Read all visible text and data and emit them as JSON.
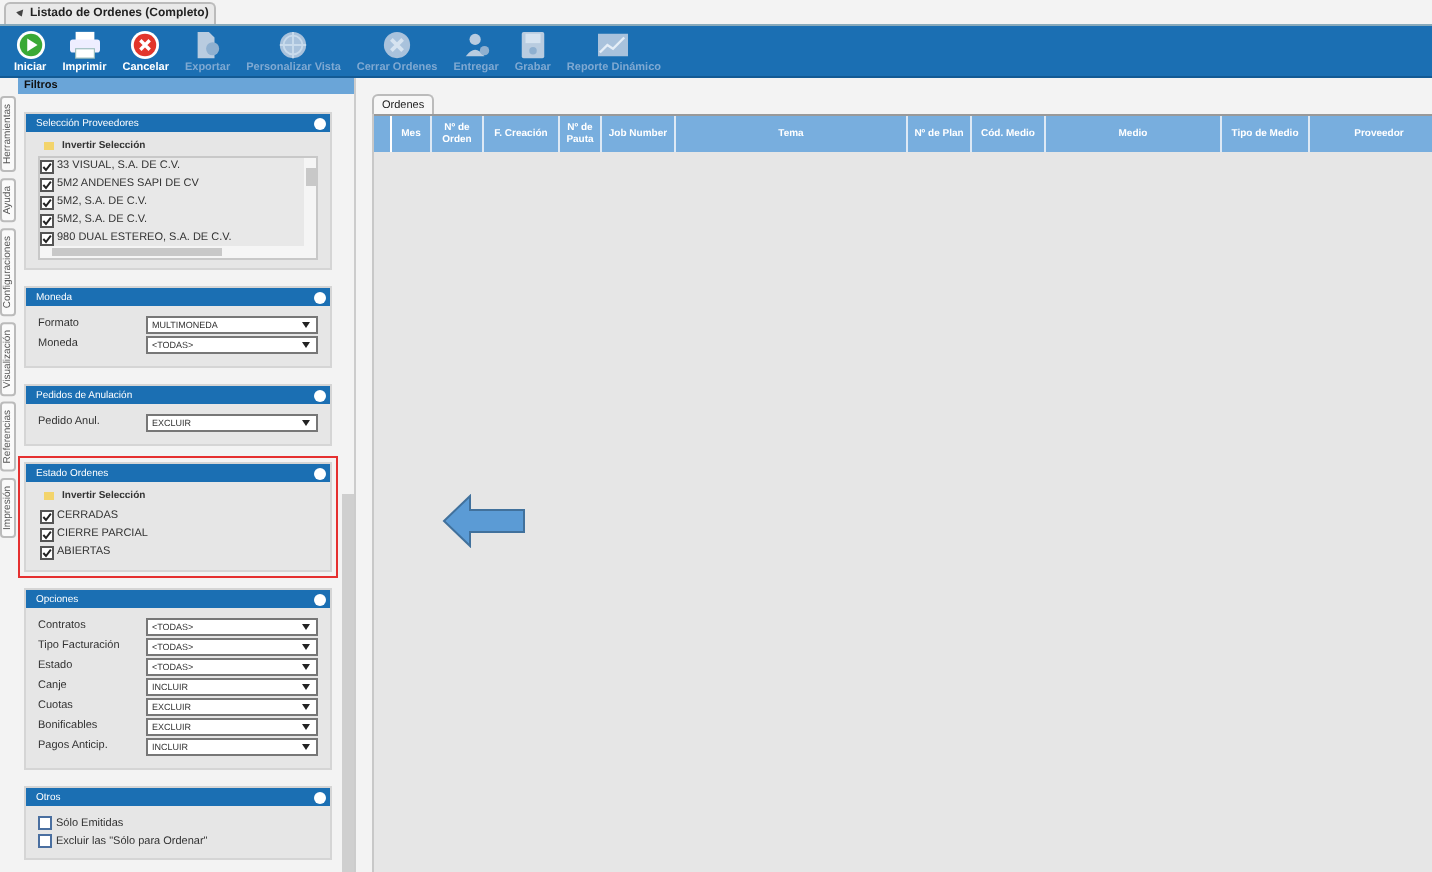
{
  "window": {
    "title": "Listado de Ordenes (Completo)"
  },
  "toolbar": [
    {
      "kind": "play",
      "label": "Iniciar",
      "disabled": false
    },
    {
      "kind": "printer",
      "label": "Imprimir",
      "disabled": false
    },
    {
      "kind": "cancel",
      "label": "Cancelar",
      "disabled": false
    },
    {
      "kind": "export",
      "label": "Exportar",
      "disabled": true
    },
    {
      "kind": "globe",
      "label": "Personalizar Vista",
      "disabled": true
    },
    {
      "kind": "cross",
      "label": "Cerrar Ordenes",
      "disabled": true
    },
    {
      "kind": "person",
      "label": "Entregar",
      "disabled": true
    },
    {
      "kind": "disk",
      "label": "Grabar",
      "disabled": true
    },
    {
      "kind": "chart",
      "label": "Reporte Dinámico",
      "disabled": true
    }
  ],
  "side_tabs": [
    "Herramientas",
    "Ayuda",
    "Configuraciones",
    "Visualización",
    "Referencias",
    "Impresión"
  ],
  "filters": {
    "title": "Filtros",
    "sections": [
      {
        "kind": "checklist",
        "title": "Selección Proveedores",
        "highlighted": false,
        "scrollable": true,
        "invert_label": "Invertir Selección",
        "items": [
          {
            "label": "33 VISUAL, S.A. DE C.V.",
            "checked": true
          },
          {
            "label": "5M2 ANDENES SAPI DE CV",
            "checked": true
          },
          {
            "label": "5M2,  S.A. DE C.V.",
            "checked": true
          },
          {
            "label": "5M2, S.A. DE C.V.",
            "checked": true
          },
          {
            "label": "980 DUAL ESTEREO, S.A. DE C.V.",
            "checked": true
          }
        ]
      },
      {
        "kind": "fields",
        "title": "Moneda",
        "highlighted": false,
        "rows": [
          {
            "label": "Formato",
            "value": "MULTIMONEDA"
          },
          {
            "label": "Moneda",
            "value": "<TODAS>"
          }
        ]
      },
      {
        "kind": "fields",
        "title": "Pedidos de Anulación",
        "highlighted": false,
        "rows": [
          {
            "label": "Pedido Anul.",
            "value": "EXCLUIR"
          }
        ]
      },
      {
        "kind": "checklist",
        "title": "Estado Ordenes",
        "highlighted": true,
        "scrollable": false,
        "invert_label": "Invertir Selección",
        "items": [
          {
            "label": "CERRADAS",
            "checked": true
          },
          {
            "label": "CIERRE PARCIAL",
            "checked": true
          },
          {
            "label": "ABIERTAS",
            "checked": true
          }
        ]
      },
      {
        "kind": "fields",
        "title": "Opciones",
        "highlighted": false,
        "rows": [
          {
            "label": "Contratos",
            "value": "<TODAS>"
          },
          {
            "label": "Tipo Facturación",
            "value": "<TODAS>"
          },
          {
            "label": "Estado",
            "value": "<TODAS>"
          },
          {
            "label": "Canje",
            "value": "INCLUIR"
          },
          {
            "label": "Cuotas",
            "value": "EXCLUIR"
          },
          {
            "label": "Bonificables",
            "value": "EXCLUIR"
          },
          {
            "label": "Pagos Anticip.",
            "value": "INCLUIR"
          }
        ]
      },
      {
        "kind": "checks",
        "title": "Otros",
        "highlighted": false,
        "items": [
          {
            "label": "Sólo Emitidas",
            "checked": false
          },
          {
            "label": "Excluir las \"Sólo para Ordenar\"",
            "checked": false
          }
        ]
      }
    ]
  },
  "main": {
    "tabs": [
      {
        "label": "Ordenes",
        "selected": true
      }
    ],
    "table": {
      "columns": [
        "Mes",
        "Nº de Orden",
        "F. Creación",
        "Nº de Pauta",
        "Job Number",
        "Tema",
        "Nº de Plan",
        "Cód. Medio",
        "Medio",
        "Tipo de Medio",
        "Proveedor"
      ]
    }
  }
}
